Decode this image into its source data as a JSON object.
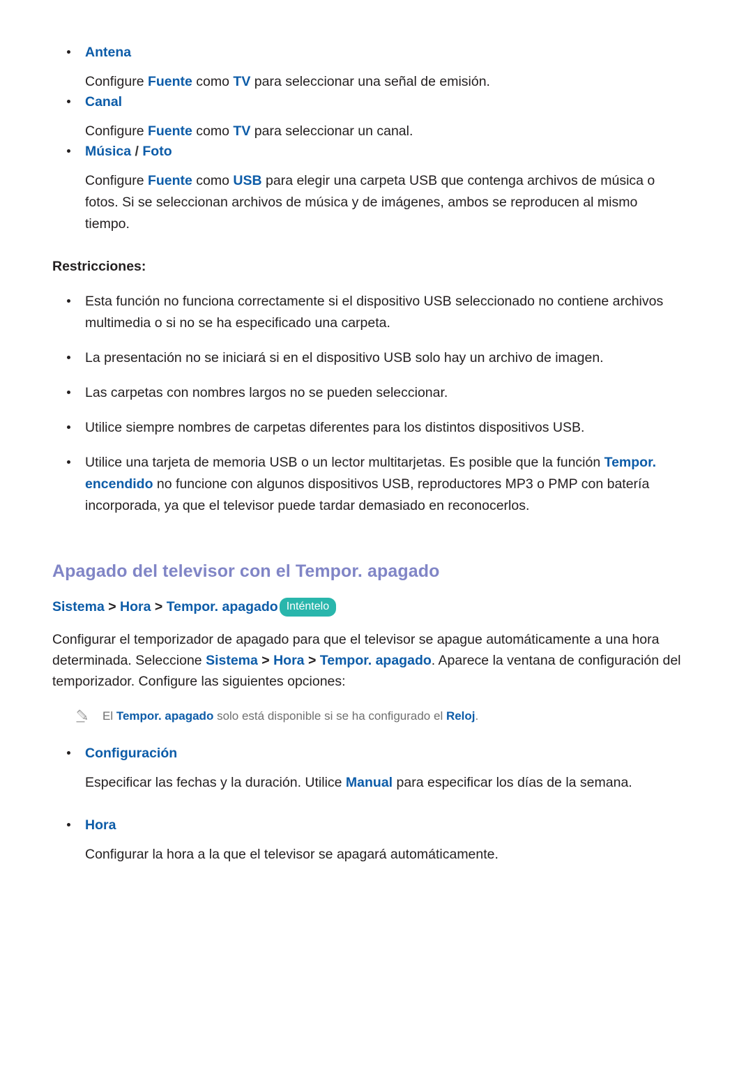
{
  "document": {
    "language": "es",
    "colors": {
      "link_blue": "#0d5ca8",
      "heading_purple": "#8085c6",
      "badge_teal": "#29b6ac",
      "body_black": "#231f20",
      "note_gray": "#6f6f6f"
    }
  },
  "source_items": [
    {
      "title": "Antena",
      "body_pre": "Configure ",
      "term1": "Fuente",
      "body_mid": " como ",
      "term2": "TV",
      "body_post": " para seleccionar una señal de emisión."
    },
    {
      "title": "Canal",
      "body_pre": "Configure ",
      "term1": "Fuente",
      "body_mid": " como ",
      "term2": "TV",
      "body_post": " para seleccionar un canal."
    },
    {
      "title_a": "Música",
      "title_slash": " / ",
      "title_b": "Foto",
      "body_pre": "Configure ",
      "term1": "Fuente",
      "body_mid": " como ",
      "term2": "USB",
      "body_post": " para elegir una carpeta USB que contenga archivos de música o fotos. Si se seleccionan archivos de música y de imágenes, ambos se reproducen al mismo tiempo."
    }
  ],
  "restrictions": {
    "label": "Restricciones:",
    "items": [
      {
        "text": "Esta función no funciona correctamente si el dispositivo USB seleccionado no contiene archivos multimedia o si no se ha especificado una carpeta."
      },
      {
        "text": "La presentación no se iniciará si en el dispositivo USB solo hay un archivo de imagen."
      },
      {
        "text": "Las carpetas con nombres largos no se pueden seleccionar."
      },
      {
        "text": "Utilice siempre nombres de carpetas diferentes para los distintos dispositivos USB."
      },
      {
        "pre": "Utilice una tarjeta de memoria USB o un lector multitarjetas. Es posible que la función ",
        "term": "Tempor. encendido",
        "post": " no funcione con algunos dispositivos USB, reproductores MP3 o PMP con batería incorporada, ya que el televisor puede tardar demasiado en reconocerlos."
      }
    ]
  },
  "section": {
    "heading": "Apagado del televisor con el Tempor. apagado",
    "breadcrumb": {
      "crumb1": "Sistema",
      "sep1": " > ",
      "crumb2": "Hora",
      "sep2": " > ",
      "crumb3": "Tempor. apagado",
      "badge": "Inténtelo"
    },
    "intro": {
      "part1": "Configurar el temporizador de apagado para que el televisor se apague automáticamente a una hora determinada. Seleccione ",
      "term1": "Sistema",
      "sep1": " > ",
      "term2": "Hora",
      "sep2": " > ",
      "term3": "Tempor. apagado",
      "part2": ". Aparece la ventana de configuración del temporizador. Configure las siguientes opciones:"
    },
    "note": {
      "icon": "pencil-icon",
      "pre": "El ",
      "term1": "Tempor. apagado",
      "mid": " solo está disponible si se ha configurado el ",
      "term2": "Reloj",
      "post": "."
    },
    "options": [
      {
        "title": "Configuración",
        "body_pre": "Especificar las fechas y la duración. Utilice ",
        "term": "Manual",
        "body_post": " para especificar los días de la semana."
      },
      {
        "title": "Hora",
        "body_pre": "Configurar la hora a la que el televisor se apagará automáticamente.",
        "term": "",
        "body_post": ""
      }
    ]
  }
}
